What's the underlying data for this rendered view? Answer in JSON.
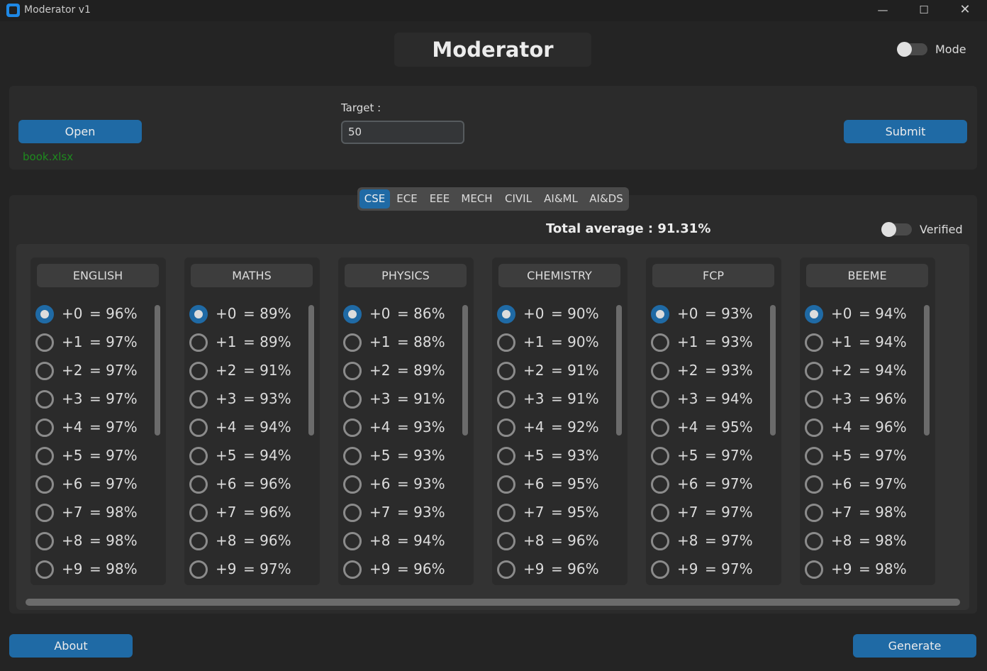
{
  "window": {
    "title": "Moderator v1",
    "minimize": "—",
    "maximize": "☐",
    "close": "✕"
  },
  "header": {
    "title": "Moderator",
    "mode_label": "Mode",
    "mode_on": false
  },
  "toolbar": {
    "open_label": "Open",
    "file_name": "book.xlsx",
    "target_label": "Target :",
    "target_value": "50",
    "submit_label": "Submit"
  },
  "tabs": [
    "CSE",
    "ECE",
    "EEE",
    "MECH",
    "CIVIL",
    "AI&ML",
    "AI&DS"
  ],
  "active_tab": "CSE",
  "summary": {
    "total_average": "Total average : 91.31%",
    "verified_label": "Verified",
    "verified_on": false
  },
  "subjects": [
    {
      "name": "ENGLISH",
      "selected": 0,
      "options": [
        {
          "inc": "+0",
          "pct": "= 96%"
        },
        {
          "inc": "+1",
          "pct": "= 97%"
        },
        {
          "inc": "+2",
          "pct": "= 97%"
        },
        {
          "inc": "+3",
          "pct": "= 97%"
        },
        {
          "inc": "+4",
          "pct": "= 97%"
        },
        {
          "inc": "+5",
          "pct": "= 97%"
        },
        {
          "inc": "+6",
          "pct": "= 97%"
        },
        {
          "inc": "+7",
          "pct": "= 98%"
        },
        {
          "inc": "+8",
          "pct": "= 98%"
        },
        {
          "inc": "+9",
          "pct": "= 98%"
        }
      ]
    },
    {
      "name": "MATHS",
      "selected": 0,
      "options": [
        {
          "inc": "+0",
          "pct": "= 89%"
        },
        {
          "inc": "+1",
          "pct": "= 89%"
        },
        {
          "inc": "+2",
          "pct": "= 91%"
        },
        {
          "inc": "+3",
          "pct": "= 93%"
        },
        {
          "inc": "+4",
          "pct": "= 94%"
        },
        {
          "inc": "+5",
          "pct": "= 94%"
        },
        {
          "inc": "+6",
          "pct": "= 96%"
        },
        {
          "inc": "+7",
          "pct": "= 96%"
        },
        {
          "inc": "+8",
          "pct": "= 96%"
        },
        {
          "inc": "+9",
          "pct": "= 97%"
        }
      ]
    },
    {
      "name": "PHYSICS",
      "selected": 0,
      "options": [
        {
          "inc": "+0",
          "pct": "= 86%"
        },
        {
          "inc": "+1",
          "pct": "= 88%"
        },
        {
          "inc": "+2",
          "pct": "= 89%"
        },
        {
          "inc": "+3",
          "pct": "= 91%"
        },
        {
          "inc": "+4",
          "pct": "= 93%"
        },
        {
          "inc": "+5",
          "pct": "= 93%"
        },
        {
          "inc": "+6",
          "pct": "= 93%"
        },
        {
          "inc": "+7",
          "pct": "= 93%"
        },
        {
          "inc": "+8",
          "pct": "= 94%"
        },
        {
          "inc": "+9",
          "pct": "= 96%"
        }
      ]
    },
    {
      "name": "CHEMISTRY",
      "selected": 0,
      "options": [
        {
          "inc": "+0",
          "pct": "= 90%"
        },
        {
          "inc": "+1",
          "pct": "= 90%"
        },
        {
          "inc": "+2",
          "pct": "= 91%"
        },
        {
          "inc": "+3",
          "pct": "= 91%"
        },
        {
          "inc": "+4",
          "pct": "= 92%"
        },
        {
          "inc": "+5",
          "pct": "= 93%"
        },
        {
          "inc": "+6",
          "pct": "= 95%"
        },
        {
          "inc": "+7",
          "pct": "= 95%"
        },
        {
          "inc": "+8",
          "pct": "= 96%"
        },
        {
          "inc": "+9",
          "pct": "= 96%"
        }
      ]
    },
    {
      "name": "FCP",
      "selected": 0,
      "options": [
        {
          "inc": "+0",
          "pct": "= 93%"
        },
        {
          "inc": "+1",
          "pct": "= 93%"
        },
        {
          "inc": "+2",
          "pct": "= 93%"
        },
        {
          "inc": "+3",
          "pct": "= 94%"
        },
        {
          "inc": "+4",
          "pct": "= 95%"
        },
        {
          "inc": "+5",
          "pct": "= 97%"
        },
        {
          "inc": "+6",
          "pct": "= 97%"
        },
        {
          "inc": "+7",
          "pct": "= 97%"
        },
        {
          "inc": "+8",
          "pct": "= 97%"
        },
        {
          "inc": "+9",
          "pct": "= 97%"
        }
      ]
    },
    {
      "name": "BEEME",
      "selected": 0,
      "options": [
        {
          "inc": "+0",
          "pct": "= 94%"
        },
        {
          "inc": "+1",
          "pct": "= 94%"
        },
        {
          "inc": "+2",
          "pct": "= 94%"
        },
        {
          "inc": "+3",
          "pct": "= 96%"
        },
        {
          "inc": "+4",
          "pct": "= 96%"
        },
        {
          "inc": "+5",
          "pct": "= 97%"
        },
        {
          "inc": "+6",
          "pct": "= 97%"
        },
        {
          "inc": "+7",
          "pct": "= 98%"
        },
        {
          "inc": "+8",
          "pct": "= 98%"
        },
        {
          "inc": "+9",
          "pct": "= 98%"
        }
      ]
    }
  ],
  "footer": {
    "about_label": "About",
    "generate_label": "Generate"
  },
  "colors": {
    "accent": "#1f6aa5",
    "background": "#242424",
    "panel": "#2b2b2b",
    "file_ok": "#1e8a1e"
  }
}
